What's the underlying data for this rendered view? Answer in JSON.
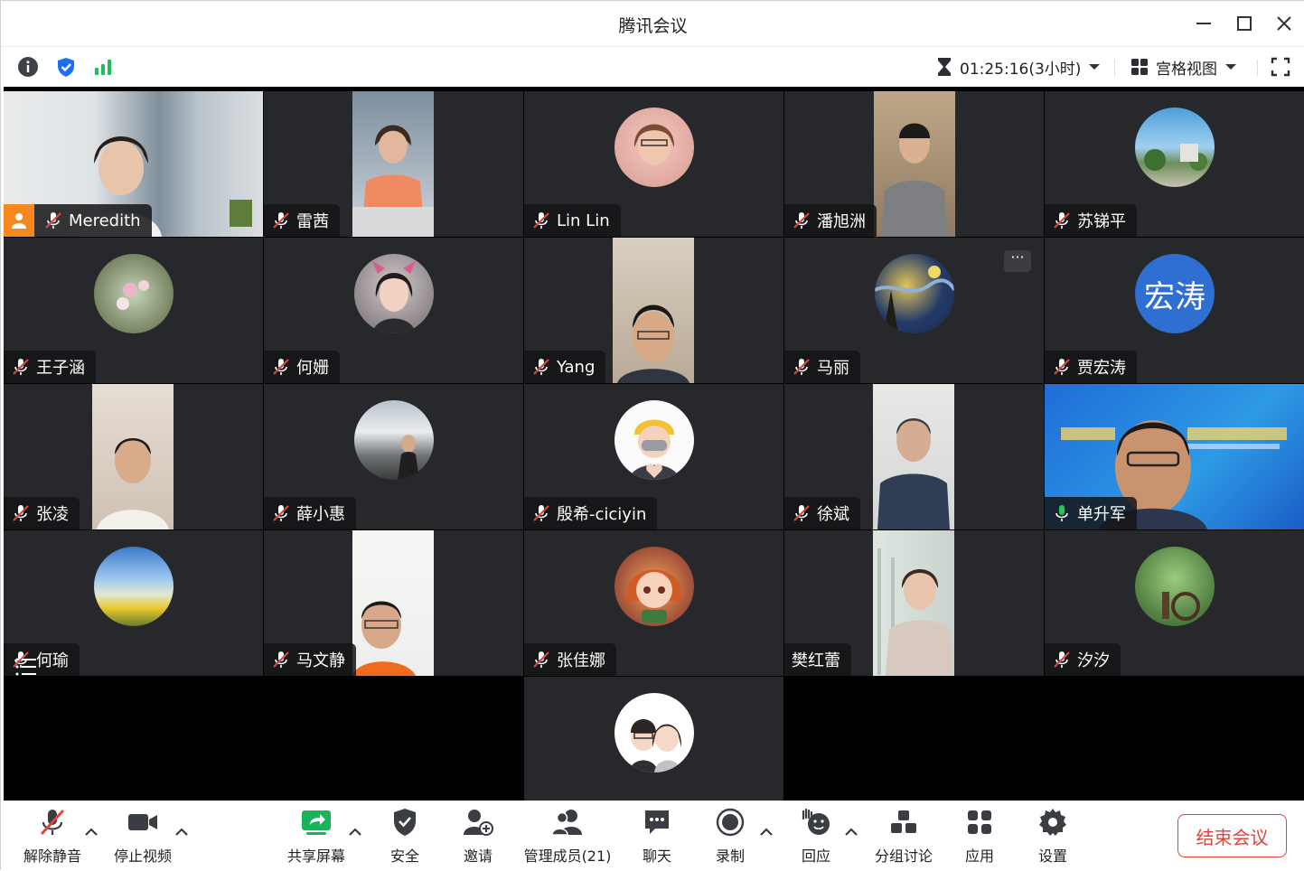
{
  "window": {
    "title": "腾讯会议"
  },
  "infobar": {
    "timer": "01:25:16(3小时)",
    "view_mode": "宫格视图"
  },
  "participants": [
    {
      "name": "Meredith",
      "host": true
    },
    {
      "name": "雷茜"
    },
    {
      "name": "Lin Lin"
    },
    {
      "name": "潘旭洲"
    },
    {
      "name": "苏锑平"
    },
    {
      "name": "王子涵"
    },
    {
      "name": "何姗"
    },
    {
      "name": "Yang"
    },
    {
      "name": "马丽"
    },
    {
      "name": "贾宏涛",
      "avatar_text": "宏涛"
    },
    {
      "name": "张凌"
    },
    {
      "name": "薛小惠"
    },
    {
      "name": "殷希-ciciyin"
    },
    {
      "name": "徐斌"
    },
    {
      "name": "单升军",
      "active_speaker": true
    },
    {
      "name": "何瑜"
    },
    {
      "name": "马文静"
    },
    {
      "name": "张佳娜"
    },
    {
      "name": "樊红蕾"
    },
    {
      "name": "汐汐"
    }
  ],
  "toolbar": {
    "unmute": "解除静音",
    "stop_video": "停止视频",
    "share_screen": "共享屏幕",
    "security": "安全",
    "invite": "邀请",
    "manage_members": "管理成员(21)",
    "chat": "聊天",
    "record": "录制",
    "reaction": "回应",
    "breakout": "分组讨论",
    "apps": "应用",
    "settings": "设置",
    "end_meeting": "结束会议"
  },
  "colors": {
    "accent_green": "#1ec85a",
    "host_orange": "#f7871f",
    "end_red": "#e0443c",
    "tile_bg": "#26282c",
    "avatar_blue": "#2f6fd1"
  }
}
